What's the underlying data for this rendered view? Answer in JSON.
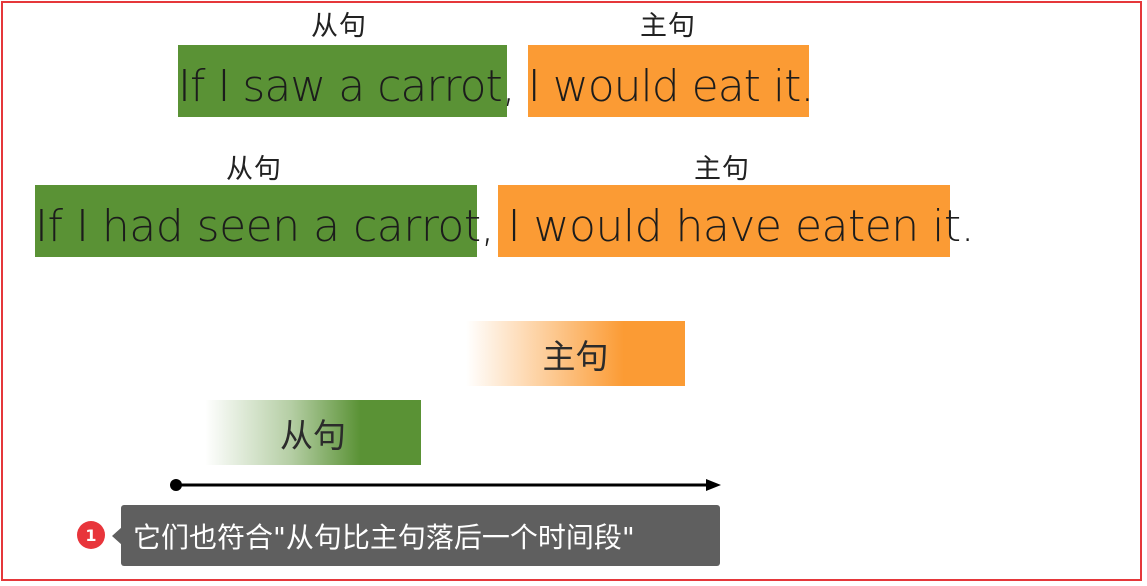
{
  "example1": {
    "sub_label": "从句",
    "main_label": "主句",
    "sub_clause": "If I saw a carrot",
    "comma": ",",
    "main_clause": " I would eat it",
    "period": "."
  },
  "example2": {
    "sub_label": "从句",
    "main_label": "主句",
    "sub_clause": "If I had seen a carrot",
    "comma": ",",
    "main_clause": " I would have eaten it",
    "period": "."
  },
  "timeline": {
    "main_block_label": "主句",
    "sub_block_label": "从句"
  },
  "annotation": {
    "badge_number": "1",
    "text": "它们也符合\"从句比主句落后一个时间段\""
  },
  "colors": {
    "subordinate_clause": "#5a9235",
    "main_clause": "#fb9b34",
    "frame": "#e5373a",
    "tooltip": "#5f5f5f",
    "badge": "#e8353b"
  }
}
